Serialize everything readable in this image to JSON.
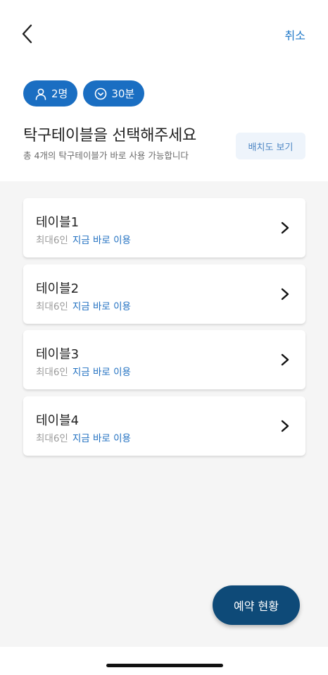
{
  "header": {
    "cancel_label": "취소"
  },
  "chips": {
    "people": "2명",
    "duration": "30분"
  },
  "title": "탁구테이블을 선택해주세요",
  "subtitle": "총 4개의 탁구테이블가 바로 사용 가능합니다",
  "layout_button": "배치도 보기",
  "tables": [
    {
      "name": "테이블1",
      "capacity": "최대6인",
      "availability": "지금 바로 이용"
    },
    {
      "name": "테이블2",
      "capacity": "최대6인",
      "availability": "지금 바로 이용"
    },
    {
      "name": "테이블3",
      "capacity": "최대6인",
      "availability": "지금 바로 이용"
    },
    {
      "name": "테이블4",
      "capacity": "최대6인",
      "availability": "지금 바로 이용"
    }
  ],
  "reserve_button": "예약 현황",
  "colors": {
    "accent": "#1a6ec2",
    "link": "#1f78c8",
    "fab": "#0e4a78",
    "list_bg": "#f5f5f5"
  }
}
